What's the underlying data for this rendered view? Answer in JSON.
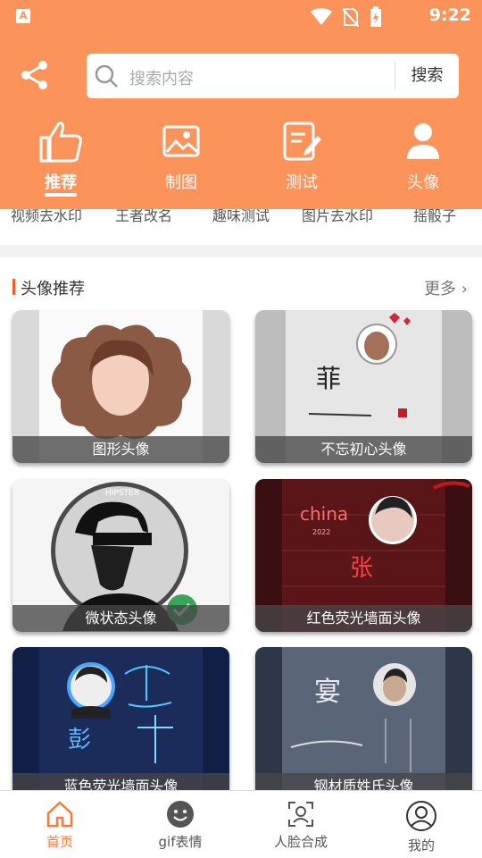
{
  "status_bar": {
    "app_badge": "A",
    "time": "9:22"
  },
  "search": {
    "placeholder": "搜索内容",
    "button": "搜索"
  },
  "tabs": [
    {
      "label": "推荐",
      "icon": "thumbs-up-icon",
      "active": true
    },
    {
      "label": "制图",
      "icon": "image-icon"
    },
    {
      "label": "测试",
      "icon": "edit-note-icon"
    },
    {
      "label": "头像",
      "icon": "person-icon"
    }
  ],
  "quick_menu": [
    "视频去水印",
    "王者改名",
    "趣味测试",
    "图片去水印",
    "摇骰子"
  ],
  "section": {
    "title": "头像推荐",
    "more": "更多"
  },
  "cards": [
    {
      "title": "图形头像"
    },
    {
      "title": "不忘初心头像",
      "art_text": "菲"
    },
    {
      "title": "微状态头像",
      "badge": "HIPSTER"
    },
    {
      "title": "红色荧光墙面头像",
      "neon": "china",
      "year": "2022",
      "art_text": "张"
    },
    {
      "title": "蓝色荧光墙面头像",
      "art_text": "彭"
    },
    {
      "title": "钢材质姓氏头像",
      "art_text": "宴"
    }
  ],
  "bottom_nav": [
    {
      "label": "首页",
      "icon": "home-icon",
      "active": true
    },
    {
      "label": "gif表情",
      "icon": "smiley-icon"
    },
    {
      "label": "人脸合成",
      "icon": "face-scan-icon"
    },
    {
      "label": "我的",
      "icon": "user-circle-icon"
    }
  ],
  "colors": {
    "accent": "#fb935a",
    "active_nav": "#fb7a3a",
    "section_bar": "#fb5a2a"
  }
}
